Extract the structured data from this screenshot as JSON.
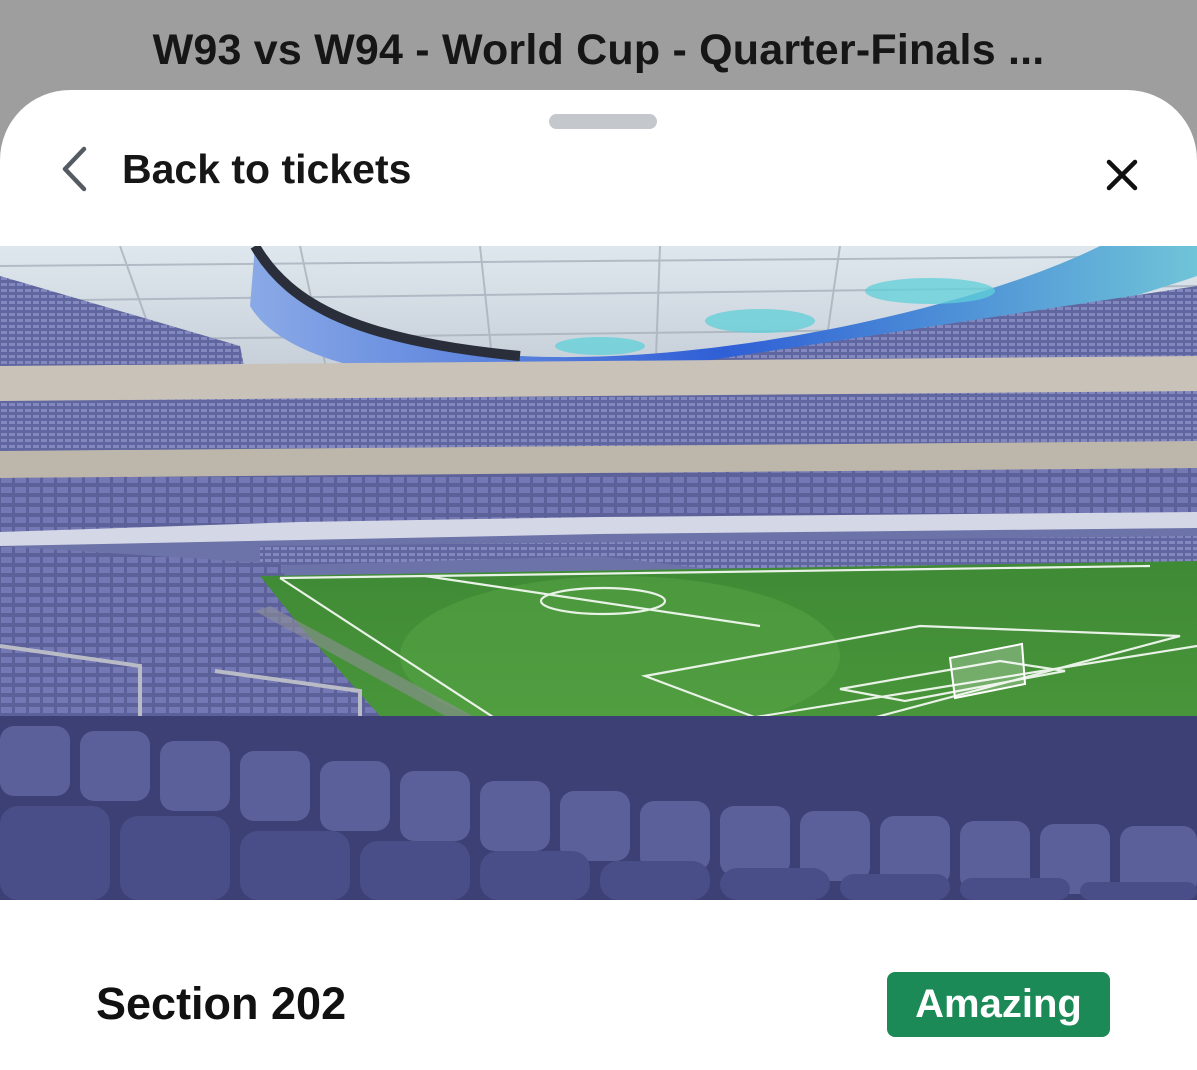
{
  "header": {
    "title": "W93 vs W94 - World Cup - Quarter-Finals ..."
  },
  "sheet": {
    "back_label": "Back to tickets",
    "back_icon": "chevron-left-icon",
    "close_icon": "close-icon"
  },
  "seat_view": {
    "image": "stadium-seat-view"
  },
  "section": {
    "label": "Section 202",
    "rating": "Amazing"
  },
  "colors": {
    "rating_badge": "#1c8a56",
    "sheet_background": "#ffffff",
    "overlay_background": "#9e9e9e"
  }
}
